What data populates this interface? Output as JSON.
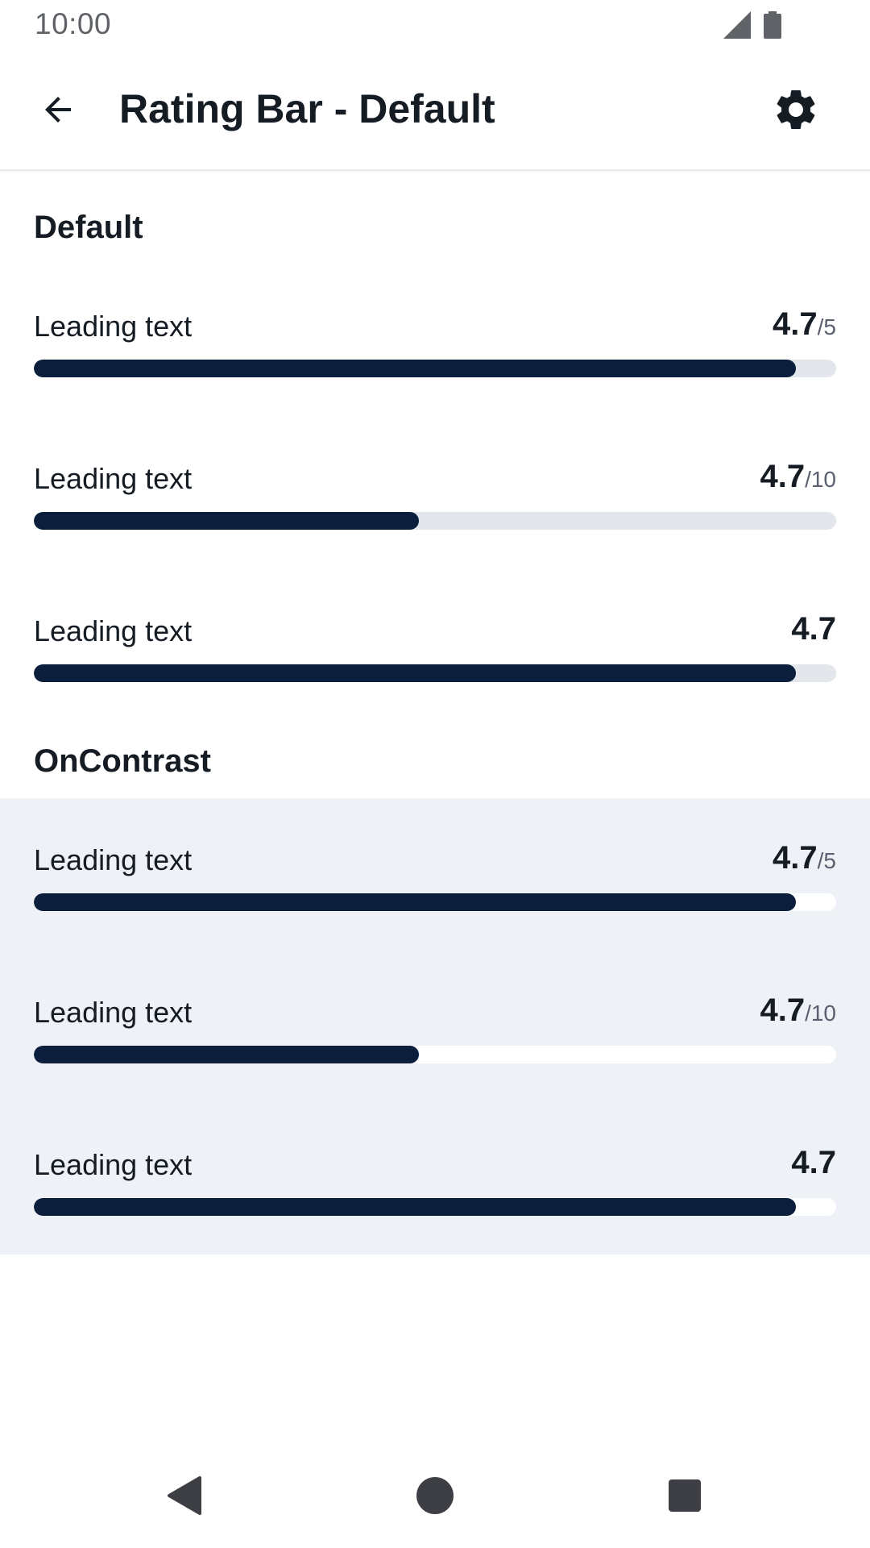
{
  "status_bar": {
    "time": "10:00",
    "icons": [
      "signal-icon",
      "battery-icon"
    ]
  },
  "app_bar": {
    "title": "Rating Bar - Default",
    "back_icon": "arrow-back-icon",
    "settings_icon": "gear-icon"
  },
  "sections": {
    "default": {
      "title": "Default",
      "rows": [
        {
          "label": "Leading text",
          "score": "4.7",
          "max": "/5",
          "fill_fraction": 0.95
        },
        {
          "label": "Leading text",
          "score": "4.7",
          "max": "/10",
          "fill_fraction": 0.48
        },
        {
          "label": "Leading text",
          "score": "4.7",
          "max": "",
          "fill_fraction": 0.95
        }
      ]
    },
    "on_contrast": {
      "title": "OnContrast",
      "rows": [
        {
          "label": "Leading text",
          "score": "4.7",
          "max": "/5",
          "fill_fraction": 0.95
        },
        {
          "label": "Leading text",
          "score": "4.7",
          "max": "/10",
          "fill_fraction": 0.48
        },
        {
          "label": "Leading text",
          "score": "4.7",
          "max": "",
          "fill_fraction": 0.95
        }
      ]
    }
  },
  "colors": {
    "fill": "#0b1f3d",
    "track": "#e3e6ea",
    "contrast_background": "#eef1f5",
    "contrast_track": "#ffffff"
  },
  "nav_bar": {
    "icons": [
      "back-triangle-icon",
      "home-circle-icon",
      "recents-square-icon"
    ]
  }
}
